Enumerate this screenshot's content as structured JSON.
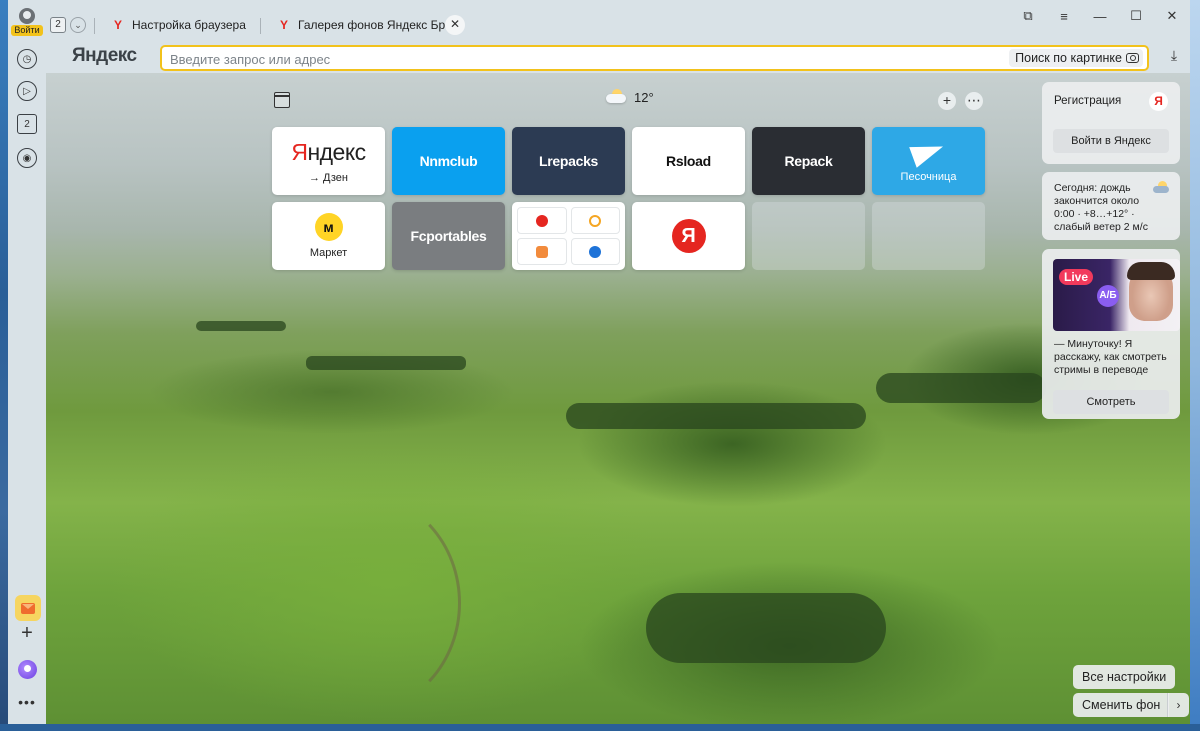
{
  "titlebar": {
    "login_label": "Войти",
    "tab_count": "2",
    "tabs": [
      {
        "title": "Настройка браузера"
      },
      {
        "title": "Галерея фонов Яндекс Бр"
      }
    ],
    "close_tab_glyph": "✕"
  },
  "window_controls": {
    "pin_glyph": "⧉",
    "menu_glyph": "≡",
    "minimize_glyph": "—",
    "maximize_glyph": "☐",
    "close_glyph": "✕"
  },
  "sidebar": {
    "items": [
      {
        "icon": "history-icon",
        "glyph": "◷"
      },
      {
        "icon": "play-icon",
        "glyph": "▷"
      },
      {
        "icon": "tabs-count-icon",
        "glyph": "2"
      },
      {
        "icon": "screenshot-icon",
        "glyph": "◉"
      }
    ],
    "add_glyph": "+",
    "more_glyph": "•••"
  },
  "addressbar": {
    "brand": "Яндекс",
    "placeholder": "Введите запрос или адрес",
    "image_search_label": "Поиск по картинке",
    "download_glyph": "⤓"
  },
  "newtab": {
    "weather_temp": "12°",
    "add_glyph": "+",
    "more_glyph": "⋯",
    "tiles": [
      {
        "name": "yandex",
        "logo": "Яндекс",
        "sub": "→ Дзен"
      },
      {
        "name": "nnmclub",
        "label": "Nnmclub",
        "color": "#0aa0ef"
      },
      {
        "name": "lrepacks",
        "label": "Lrepacks",
        "color": "#2c3b53"
      },
      {
        "name": "rsload",
        "label": "Rsload"
      },
      {
        "name": "repack",
        "label": "Repack",
        "color": "#2a2d33"
      },
      {
        "name": "sandbox",
        "label": "Песочница",
        "color": "#2ea8e6"
      },
      {
        "name": "market",
        "icon_glyph": "м",
        "label": "Маркет"
      },
      {
        "name": "fcportables",
        "label": "Fcportables",
        "color": "#7a7d80"
      },
      {
        "name": "services-group"
      },
      {
        "name": "yandex-circle",
        "glyph": "Я"
      }
    ]
  },
  "widgets": {
    "registration": {
      "title": "Регистрация",
      "badge": "Я",
      "button": "Войти в Яндекс"
    },
    "weather": {
      "text": "Сегодня: дождь закончится около 0:00 · +8…+12° · слабый ветер 2 м/с"
    },
    "stream": {
      "live_label": "Live",
      "aa_label": "A/Б",
      "text": "— Минуточку! Я расскажу, как смотреть стримы в переводе",
      "button": "Смотреть"
    }
  },
  "footer": {
    "all_settings": "Все настройки",
    "change_bg": "Сменить фон",
    "chevron_glyph": "›"
  },
  "colors": {
    "accent": "#f2c21b",
    "yandex_red": "#e52620"
  }
}
